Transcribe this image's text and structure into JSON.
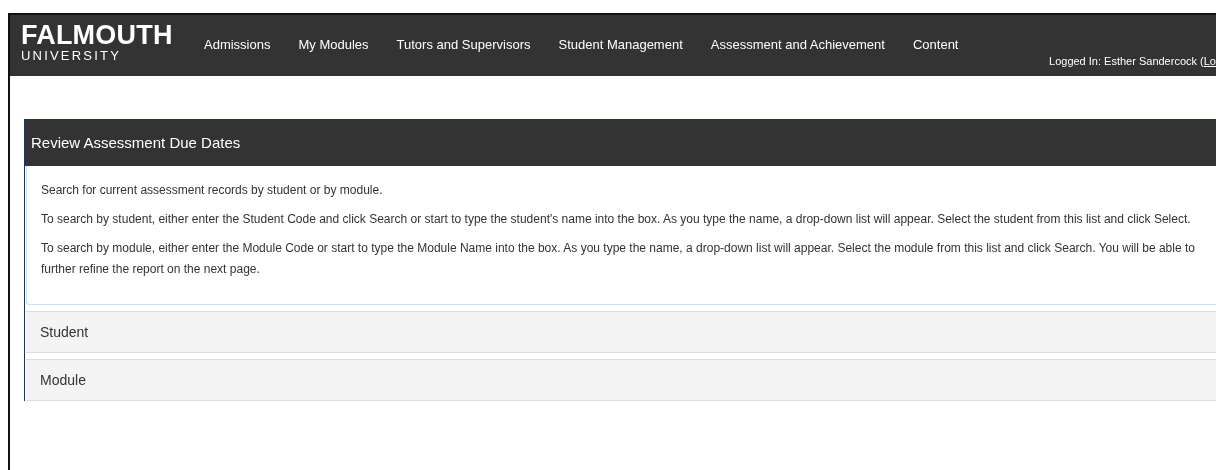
{
  "header": {
    "logo_title": "FALMOUTH",
    "logo_subtitle": "UNIVERSITY",
    "nav_items": [
      {
        "label": "Admissions"
      },
      {
        "label": "My Modules"
      },
      {
        "label": "Tutors and Supervisors"
      },
      {
        "label": "Student Management"
      },
      {
        "label": "Assessment and Achievement"
      },
      {
        "label": "Content"
      }
    ],
    "user_label": "Logged In: Esther Sandercock (",
    "logout_link": "Lo"
  },
  "panel": {
    "title": "Review Assessment Due Dates",
    "paragraphs": [
      "Search for current assessment records by student or by module.",
      "To search by student, either enter the Student Code and click Search or start to type the student's name into the box. As you type the name, a drop-down list will appear. Select the student from this list and click Select.",
      "To search by module, either enter the Module Code or start to type the Module Name into the box. As you type the name, a drop-down list will appear. Select the module from this list and click Search. You will be able to further refine the report on the next page."
    ],
    "sections": [
      {
        "title": "Student",
        "expanded": false
      },
      {
        "title": "Module",
        "expanded": false
      }
    ]
  }
}
